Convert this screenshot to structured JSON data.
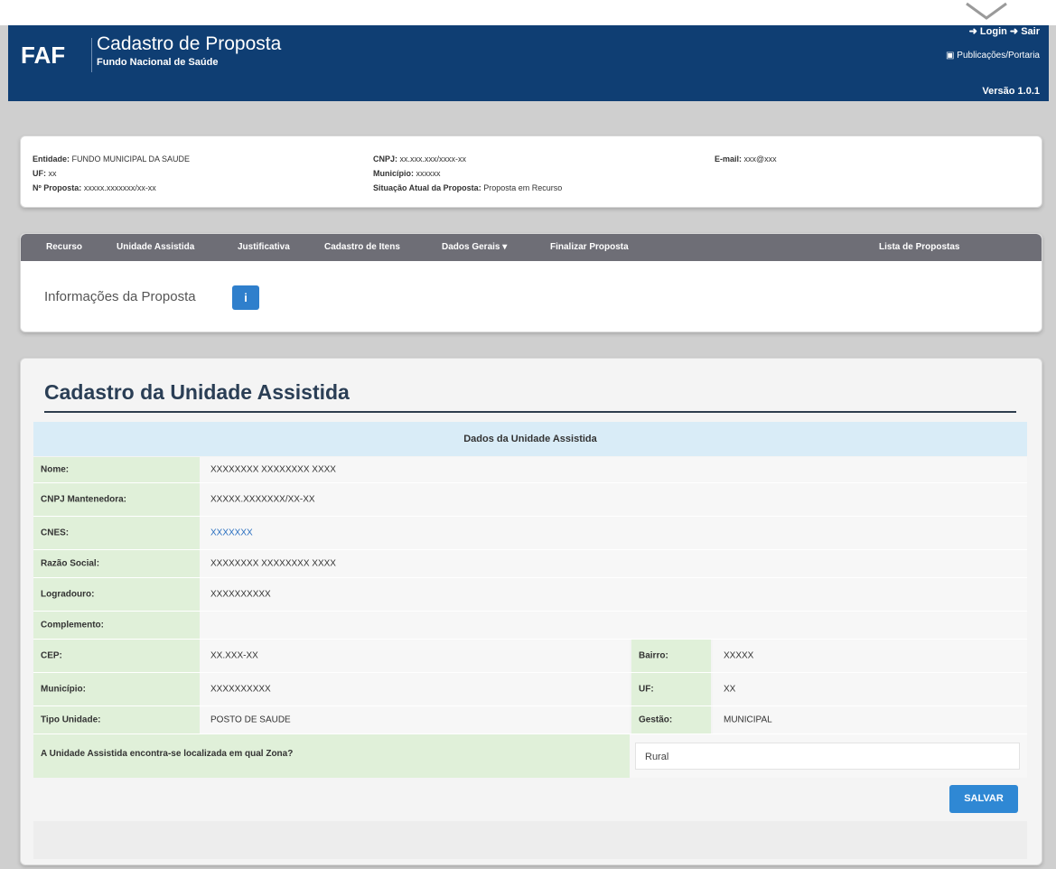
{
  "header": {
    "logo": "FAF",
    "title": "Cadastro de Proposta",
    "subtitle": "Fundo Nacional de Saúde",
    "login_label": "Login",
    "exit_label": "Sair",
    "publicacoes_label": "Publicações/Portaria",
    "version": "Versão 1.0.1"
  },
  "info": {
    "entidade_label": "Entidade:",
    "entidade_value": "FUNDO MUNICIPAL DA SAUDE",
    "uf_label": "UF:",
    "uf_value": "xx",
    "proposta_label": "Nº Proposta:",
    "proposta_value": "xxxxx.xxxxxxx/xx-xx",
    "cnpj_label": "CNPJ:",
    "cnpj_value": "xx.xxx.xxx/xxxx-xx",
    "municipio_label": "Município:",
    "municipio_value": "xxxxxx",
    "situacao_label": "Situação Atual da Proposta:",
    "situacao_value": "Proposta em Recurso",
    "email_label": "E-mail:",
    "email_value": "xxx@xxx"
  },
  "nav": {
    "items": [
      "Recurso",
      "Unidade Assistida",
      "Justificativa",
      "Cadastro de Itens",
      "Dados Gerais ▾",
      "Finalizar Proposta"
    ],
    "right_item": "Lista de Propostas"
  },
  "info_section": {
    "title": "Informações da Proposta",
    "button_icon": "info-icon",
    "button_glyph": "i"
  },
  "form": {
    "title": "Cadastro da Unidade Assistida",
    "section_header": "Dados da Unidade Assistida",
    "nome_label": "Nome:",
    "nome_value": "XXXXXXXX XXXXXXXX XXXX",
    "cnpj_label": "CNPJ Mantenedora:",
    "cnpj_value": "XXXXX.XXXXXXX/XX-XX",
    "cnes_label": "CNES:",
    "cnes_value": "XXXXXXX",
    "razao_label": "Razão Social:",
    "razao_value": "XXXXXXXX XXXXXXXX XXXX",
    "logradouro_label": "Logradouro:",
    "logradouro_value": "XXXXXXXXXX",
    "complemento_label": "Complemento:",
    "complemento_value": "",
    "cep_label": "CEP:",
    "cep_value": "XX.XXX-XX",
    "bairro_label": "Bairro:",
    "bairro_value": "XXXXX",
    "municipio_label": "Município:",
    "municipio_value": "XXXXXXXXXX",
    "uf_label": "UF:",
    "uf_value": "XX",
    "tipo_label": "Tipo Unidade:",
    "tipo_value": "POSTO DE SAUDE",
    "gestao_label": "Gestão:",
    "gestao_value": "MUNICIPAL",
    "zona_question": "A Unidade Assistida encontra-se localizada em qual Zona?",
    "zona_value": "Rural",
    "save_label": "SALVAR"
  },
  "colors": {
    "header_bg": "#0f3e73",
    "nav_bg": "#6e6e76",
    "label_bg": "#e0f0d9",
    "section_header_bg": "#d9ecf7",
    "accent": "#2f88d4"
  }
}
